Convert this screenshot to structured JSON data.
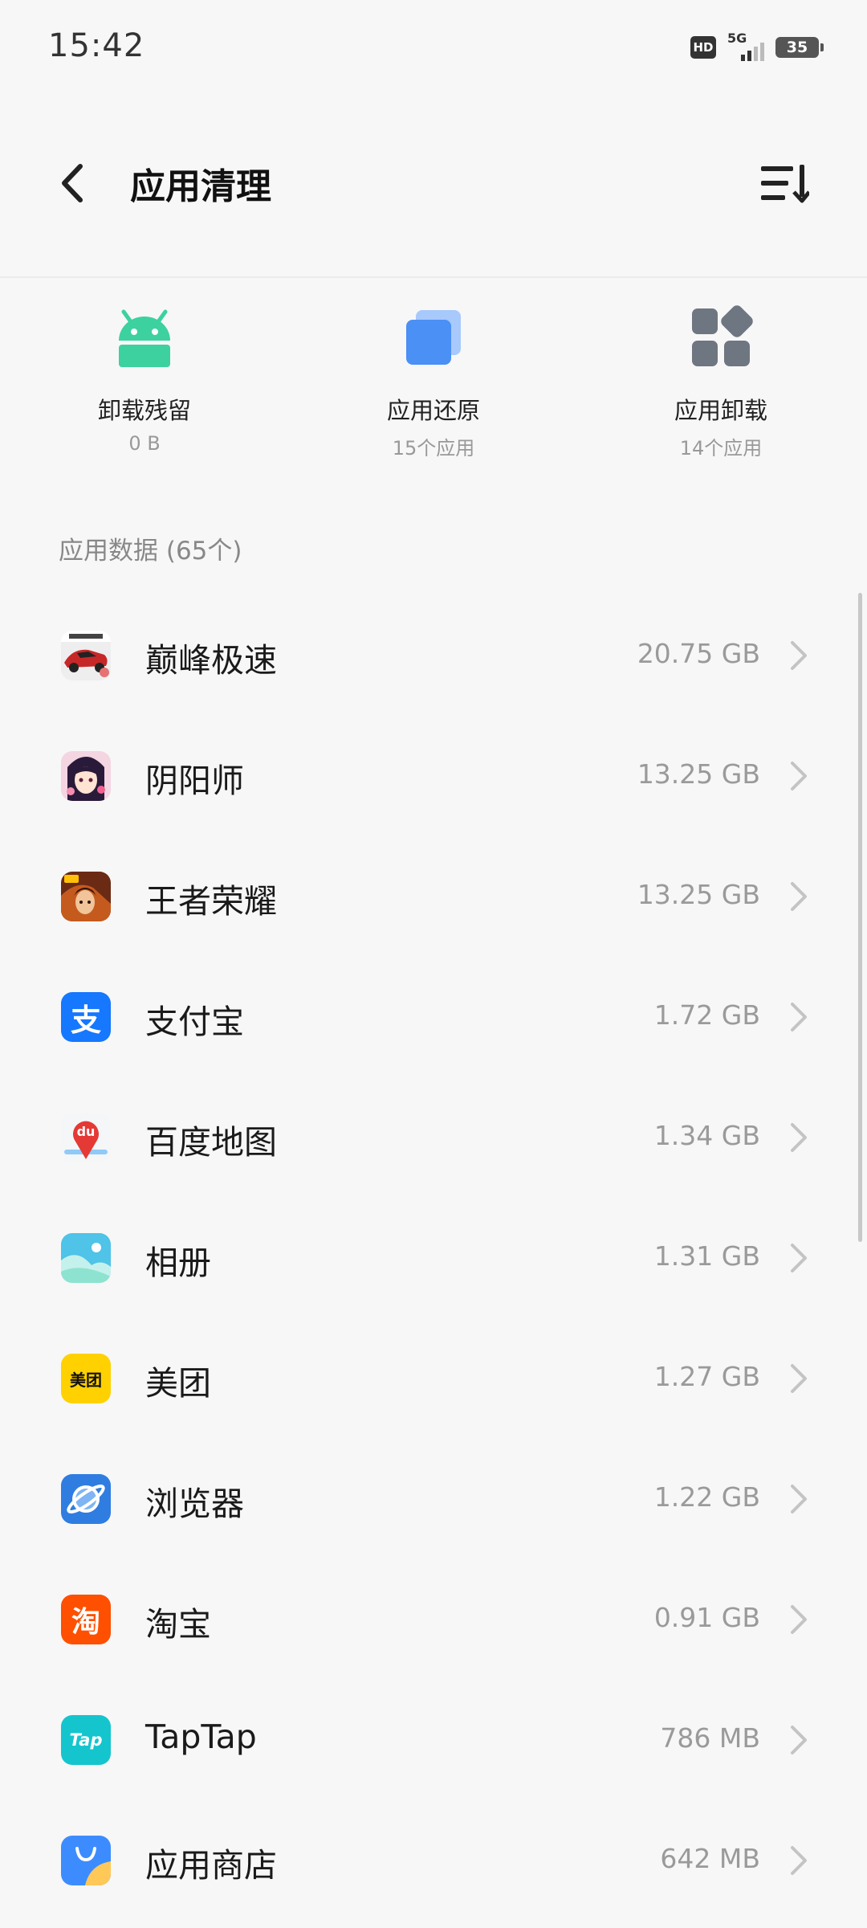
{
  "status_bar": {
    "time": "15:42",
    "hd": "HD",
    "network": "5G",
    "battery": "35"
  },
  "header": {
    "title": "应用清理",
    "back_icon": "back-arrow-icon",
    "sort_icon": "sort-list-icon"
  },
  "quick_actions": [
    {
      "label": "卸载残留",
      "sub": "0 B",
      "icon": "android-icon",
      "color": "#3dd1a0"
    },
    {
      "label": "应用还原",
      "sub": "15个应用",
      "icon": "restore-layers-icon",
      "color": "#4a90f5"
    },
    {
      "label": "应用卸载",
      "sub": "14个应用",
      "icon": "app-grid-icon",
      "color": "#6e7681"
    }
  ],
  "section": {
    "title": "应用数据 (65个)"
  },
  "apps": [
    {
      "name": "巅峰极速",
      "size": "20.75 GB",
      "icon": "racing-car-icon"
    },
    {
      "name": "阴阳师",
      "size": "13.25 GB",
      "icon": "onmyoji-icon"
    },
    {
      "name": "王者荣耀",
      "size": "13.25 GB",
      "icon": "honor-of-kings-icon"
    },
    {
      "name": "支付宝",
      "size": "1.72 GB",
      "icon": "alipay-icon",
      "color": "#1677ff"
    },
    {
      "name": "百度地图",
      "size": "1.34 GB",
      "icon": "baidu-map-icon",
      "color": "#e53935"
    },
    {
      "name": "相册",
      "size": "1.31 GB",
      "icon": "gallery-icon",
      "color": "#5cc6e8"
    },
    {
      "name": "美团",
      "size": "1.27 GB",
      "icon": "meituan-icon",
      "color": "#ffd100"
    },
    {
      "name": "浏览器",
      "size": "1.22 GB",
      "icon": "browser-icon",
      "color": "#2f7de1"
    },
    {
      "name": "淘宝",
      "size": "0.91 GB",
      "icon": "taobao-icon",
      "color": "#ff4f00"
    },
    {
      "name": "TapTap",
      "size": "786 MB",
      "icon": "taptap-icon",
      "color": "#15c5ce"
    },
    {
      "name": "应用商店",
      "size": "642 MB",
      "icon": "app-store-icon",
      "color": "#3d8cff"
    }
  ],
  "app_icon_labels": {
    "alipay": "支",
    "baidu": "du",
    "meituan": "美团",
    "taobao": "淘",
    "taptap": "Tap"
  }
}
